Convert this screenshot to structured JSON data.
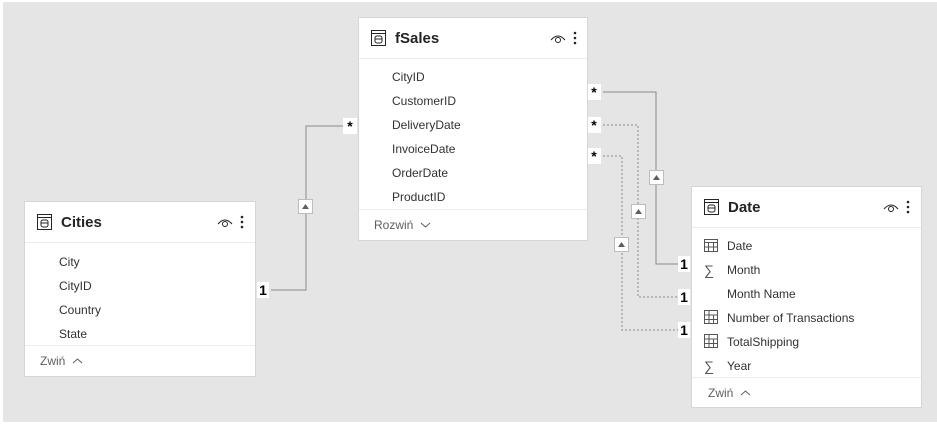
{
  "tables": {
    "fsales": {
      "title": "fSales",
      "fields": [
        "CityID",
        "CustomerID",
        "DeliveryDate",
        "InvoiceDate",
        "OrderDate",
        "ProductID"
      ],
      "collapse_label": "Rozwiń"
    },
    "cities": {
      "title": "Cities",
      "fields": [
        "City",
        "CityID",
        "Country",
        "State"
      ],
      "collapse_label": "Zwiń"
    },
    "date": {
      "title": "Date",
      "fields": [
        {
          "label": "Date",
          "icon": "calendar-icon"
        },
        {
          "label": "Month",
          "icon": "sigma-icon"
        },
        {
          "label": "Month Name",
          "icon": ""
        },
        {
          "label": "Number of Transactions",
          "icon": "calculator-icon"
        },
        {
          "label": "TotalShipping",
          "icon": "calculator-icon"
        },
        {
          "label": "Year",
          "icon": "sigma-icon"
        }
      ],
      "collapse_label": "Zwiń"
    }
  },
  "relationships": {
    "many_label": "*",
    "one_label": "1"
  },
  "colors": {
    "canvas": "#e5e5e5",
    "card": "#ffffff",
    "line": "#8a8a8a"
  }
}
